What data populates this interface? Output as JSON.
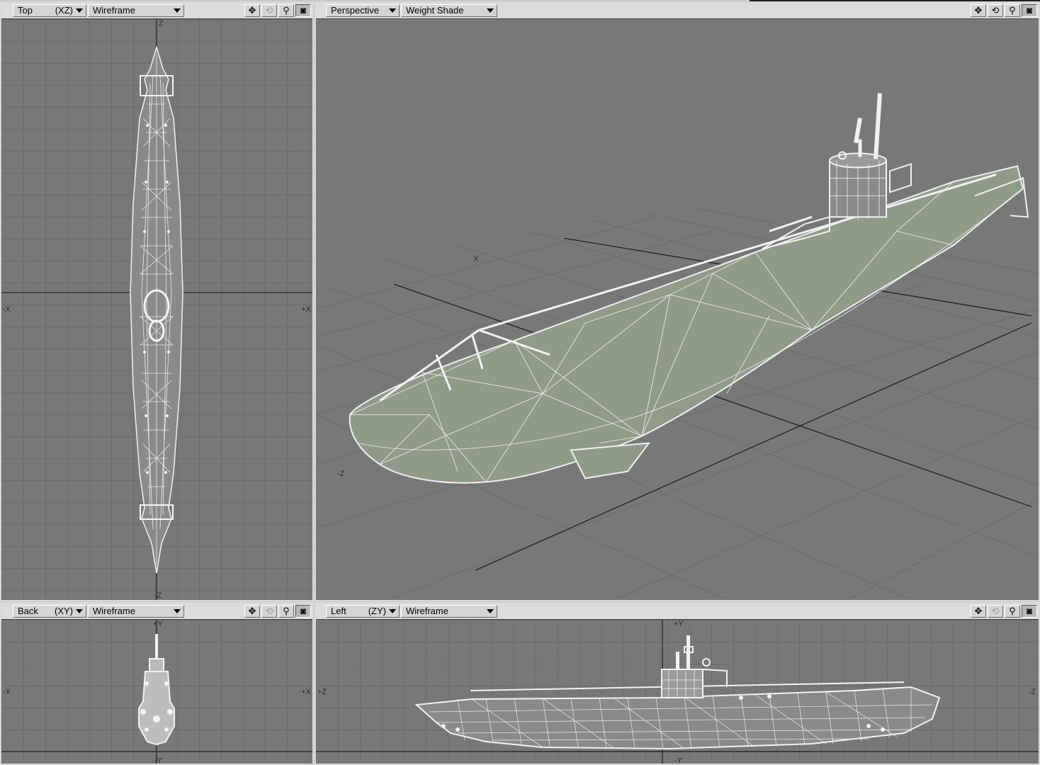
{
  "viewports": {
    "top": {
      "view": "Top",
      "axis_code": "(XZ)",
      "mode": "Wireframe",
      "axes": {
        "north": "Z",
        "south": "-Z",
        "west": "-X",
        "east": "+X"
      }
    },
    "perspective": {
      "view": "Perspective",
      "mode": "Weight Shade",
      "axes": {
        "x": "X",
        "z": "-Z"
      }
    },
    "back": {
      "view": "Back",
      "axis_code": "(XY)",
      "mode": "Wireframe",
      "axes": {
        "north": "+Y",
        "south": "-Y",
        "west": "-X",
        "east": "+X"
      }
    },
    "left": {
      "view": "Left",
      "axis_code": "(ZY)",
      "mode": "Wireframe",
      "axes": {
        "north": "+Y",
        "south": "-Y",
        "west": "+Z",
        "east": "-Z"
      }
    }
  },
  "tools": {
    "move": "✥",
    "rotate": "⟲",
    "zoom": "⚲",
    "maximize": "◙"
  },
  "icons": [
    "move-icon",
    "rotate-icon",
    "zoom-icon",
    "maximize-icon",
    "dropdown-arrow-icon"
  ],
  "colors": {
    "viewport_bg": "#787878",
    "grid_line": "#6a6a6a",
    "wire": "#f2f2f2",
    "hull_shade": "#8e9a86",
    "toolbar": "#dcdcdc"
  }
}
